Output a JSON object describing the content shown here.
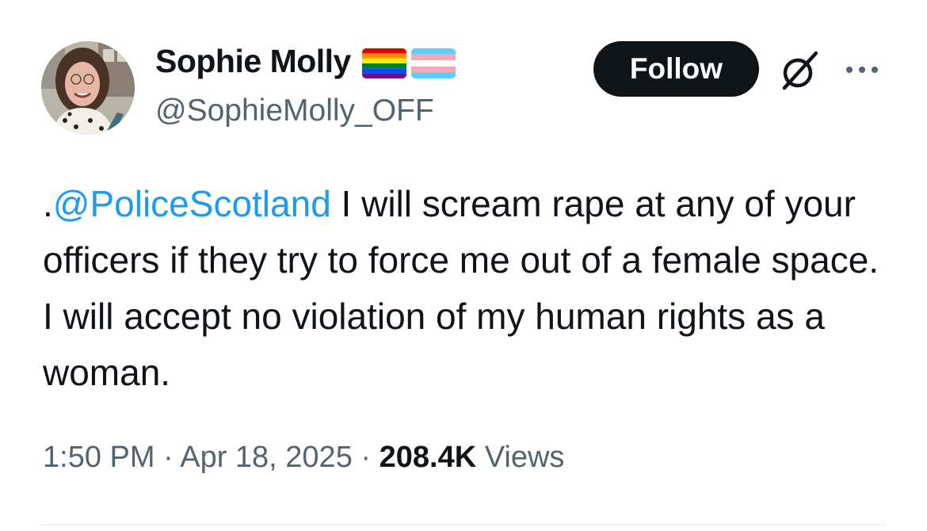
{
  "author": {
    "display_name": "Sophie Molly",
    "handle": "@SophieMolly_OFF",
    "flags": [
      "rainbow-pride-flag",
      "transgender-flag"
    ]
  },
  "actions": {
    "follow_label": "Follow",
    "grok_icon": "grok-icon",
    "more_icon": "more-icon"
  },
  "tweet": {
    "prefix": ".",
    "mention": "@PoliceScotland",
    "text": " I will scream rape at any of your officers if they try to force me out of a female space. I will accept no violation of my human rights as a woman."
  },
  "meta": {
    "time": "1:50 PM",
    "date": "Apr 18, 2025",
    "views_count": "208.4K",
    "views_label": "Views"
  },
  "colors": {
    "text": "#0f1419",
    "secondary": "#536471",
    "link": "#1d9bf0",
    "button_bg": "#0f1419",
    "divider": "#eff3f4"
  }
}
